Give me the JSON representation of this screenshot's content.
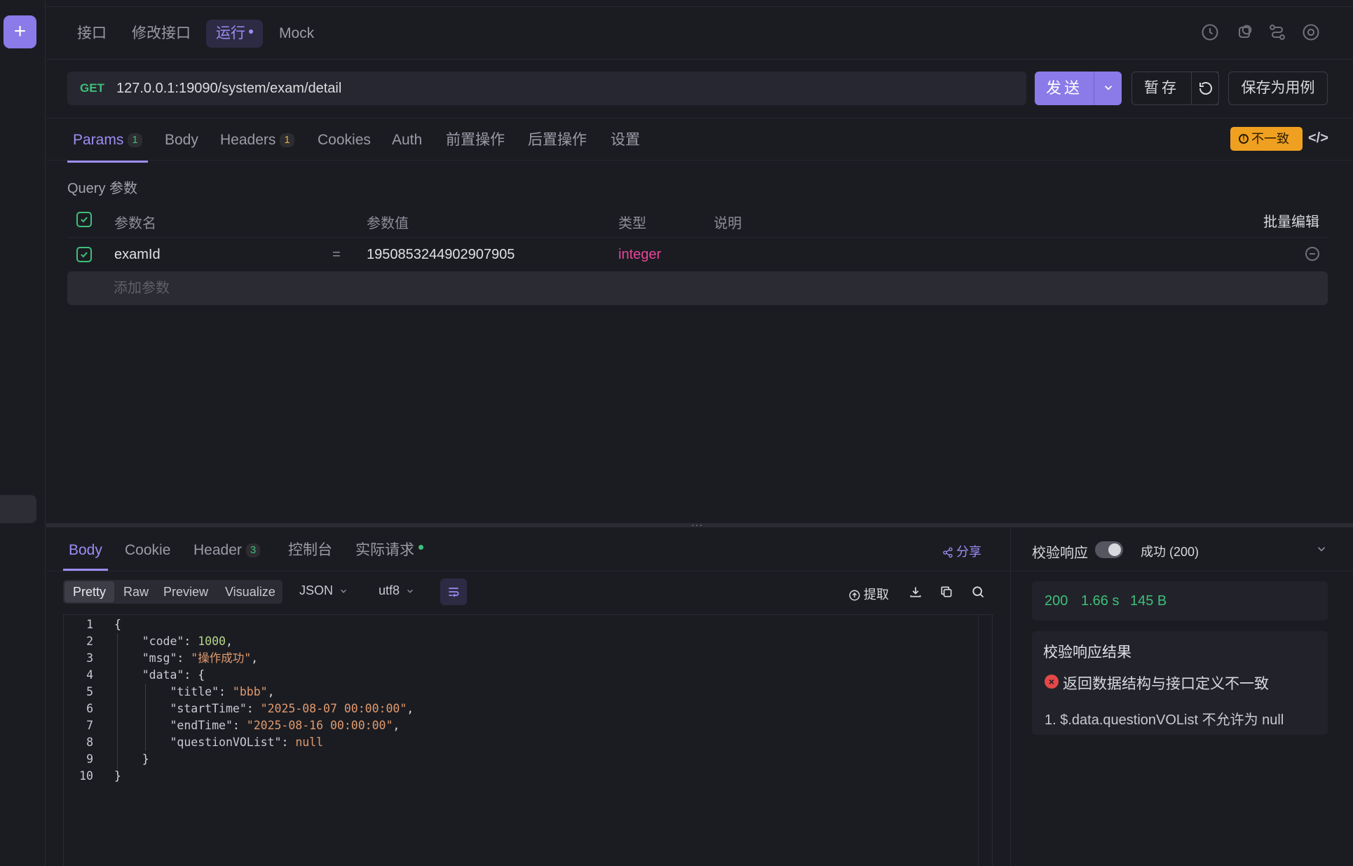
{
  "rail": {
    "add_label": "+"
  },
  "top_tabs": [
    "接口",
    "修改接口",
    "运行",
    "Mock"
  ],
  "request": {
    "method": "GET",
    "url": "127.0.0.1:19090/system/exam/detail",
    "send_label": "发送",
    "save_draft_label": "暂存",
    "save_case_label": "保存为用例"
  },
  "req_tabs": [
    {
      "label": "Params",
      "badge": "1"
    },
    {
      "label": "Body"
    },
    {
      "label": "Headers",
      "badge": "1"
    },
    {
      "label": "Cookies"
    },
    {
      "label": "Auth"
    },
    {
      "label": "前置操作"
    },
    {
      "label": "后置操作"
    },
    {
      "label": "设置"
    }
  ],
  "mismatch_label": "不一致",
  "query": {
    "title": "Query 参数",
    "headers": {
      "name": "参数名",
      "value": "参数值",
      "type": "类型",
      "desc": "说明"
    },
    "batch_edit": "批量编辑",
    "rows": [
      {
        "name": "examId",
        "eq": "=",
        "value": "1950853244902907905",
        "type": "integer"
      }
    ],
    "add_placeholder": "添加参数"
  },
  "res_tabs": [
    {
      "label": "Body"
    },
    {
      "label": "Cookie"
    },
    {
      "label": "Header",
      "badge": "3"
    },
    {
      "label": "控制台"
    },
    {
      "label": "实际请求"
    }
  ],
  "share_label": "分享",
  "view_modes": [
    "Pretty",
    "Raw",
    "Preview",
    "Visualize"
  ],
  "format": "JSON",
  "encoding": "utf8",
  "extract_label": "提取",
  "code_lines": [
    "{",
    "    \"code\": 1000,",
    "    \"msg\": \"操作成功\",",
    "    \"data\": {",
    "        \"title\": \"bbb\",",
    "        \"startTime\": \"2025-08-07 00:00:00\",",
    "        \"endTime\": \"2025-08-16 00:00:00\",",
    "        \"questionVOList\": null",
    "    }",
    "}"
  ],
  "validation": {
    "label": "校验响应",
    "status": "成功 (200)",
    "metrics": {
      "code": "200",
      "time": "1.66 s",
      "size": "145 B"
    },
    "result_title": "校验响应结果",
    "error": "返回数据结构与接口定义不一致",
    "detail": "1. $.data.questionVOList 不允许为 null"
  },
  "colors": {
    "accent": "#8a7be8",
    "success": "#3fbf7a",
    "warning": "#f0a020",
    "error": "#e34848",
    "type": "#e8459a"
  }
}
